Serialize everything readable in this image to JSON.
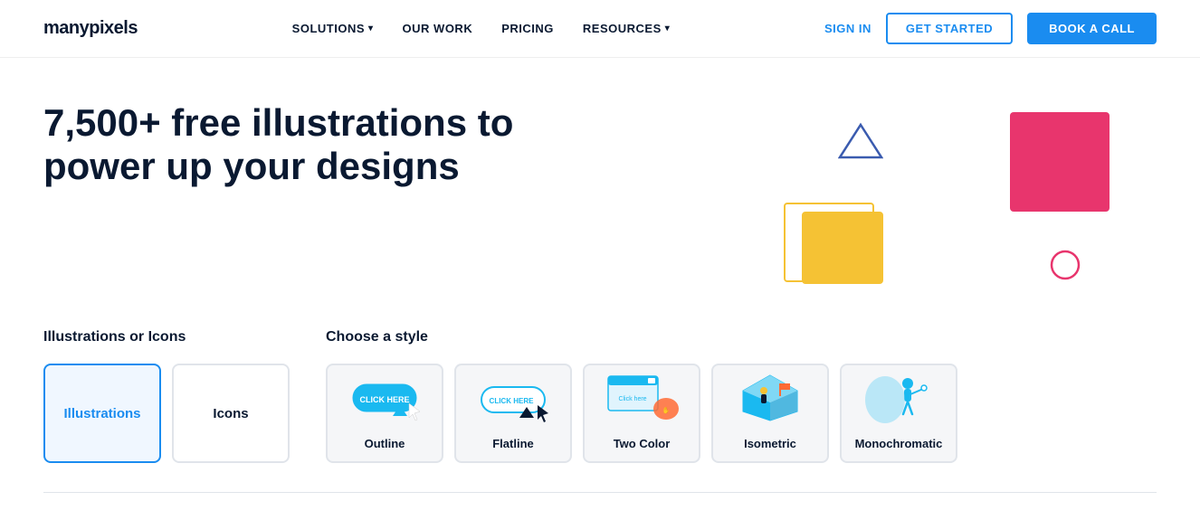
{
  "header": {
    "logo": "manypixels",
    "nav": [
      {
        "label": "SOLUTIONS",
        "hasDropdown": true
      },
      {
        "label": "OUR WORK",
        "hasDropdown": false
      },
      {
        "label": "PRICING",
        "hasDropdown": false
      },
      {
        "label": "RESOURCES",
        "hasDropdown": true
      }
    ],
    "actions": {
      "signin": "SIGN IN",
      "get_started": "GET STARTED",
      "book_call": "BOOK A CALL"
    }
  },
  "hero": {
    "title_line1": "7,500+ free illustrations to",
    "title_line2": "power up your designs"
  },
  "illustrations_section": {
    "type_label": "Illustrations or Icons",
    "types": [
      {
        "id": "illustrations",
        "label": "Illustrations",
        "active": true
      },
      {
        "id": "icons",
        "label": "Icons",
        "active": false
      }
    ],
    "style_label": "Choose a style",
    "styles": [
      {
        "id": "outline",
        "label": "Outline"
      },
      {
        "id": "flatline",
        "label": "Flatline"
      },
      {
        "id": "two-color",
        "label": "Two Color"
      },
      {
        "id": "isometric",
        "label": "Isometric"
      },
      {
        "id": "monochromatic",
        "label": "Monochromatic"
      }
    ]
  }
}
